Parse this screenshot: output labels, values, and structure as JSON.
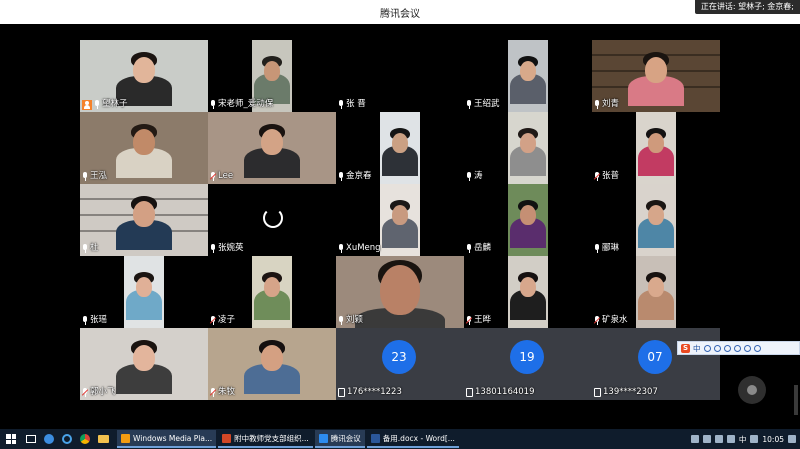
{
  "window": {
    "title": "腾讯会议"
  },
  "speaking": {
    "text": "正在讲话: 望林子; 金京春;"
  },
  "tiles": [
    {
      "name": "望林子",
      "host": true,
      "mic": "on",
      "col": 0,
      "row": 0,
      "active": true,
      "wall": "#c9ccc8",
      "skin": "#e1b59a",
      "shirt": "#2a2a2a",
      "hair": "#1b1411",
      "vl": 0,
      "vw": 128
    },
    {
      "name": "宋老师_爱动保",
      "mic": "on",
      "col": 1,
      "row": 0,
      "wall": "#c7c6bd",
      "skin": "#c79677",
      "shirt": "#6b7b6a",
      "hair": "#22201c",
      "vl": 44,
      "vw": 40
    },
    {
      "name": "张 晋",
      "mic": "on",
      "col": 2,
      "row": 0,
      "blank": true
    },
    {
      "name": "王绍武",
      "mic": "on",
      "col": 3,
      "row": 0,
      "wall": "#bfc3c6",
      "skin": "#d8a98a",
      "shirt": "#5a5f6a",
      "hair": "#111",
      "vl": 44,
      "vw": 40
    },
    {
      "name": "刘青",
      "mic": "on",
      "col": 4,
      "row": 0,
      "wall": "#5a4634",
      "skin": "#d7a384",
      "shirt": "#d97a86",
      "hair": "#1a1410",
      "vl": 0,
      "vw": 128,
      "shelves": true
    },
    {
      "name": "王泓",
      "mic": "on",
      "col": 0,
      "row": 1,
      "wall": "#8c7b6a",
      "skin": "#c18a68",
      "shirt": "#d9d2c4",
      "hair": "#231a14",
      "vl": 0,
      "vw": 128
    },
    {
      "name": "Lee",
      "mic": "off",
      "col": 1,
      "row": 1,
      "wall": "#a89586",
      "skin": "#d3a386",
      "shirt": "#2c2c2e",
      "hair": "#1a1310",
      "vl": 0,
      "vw": 128
    },
    {
      "name": "金京春",
      "mic": "on",
      "col": 2,
      "row": 1,
      "wall": "#dfe3e6",
      "skin": "#caa083",
      "shirt": "#2d3137",
      "hair": "#151515",
      "vl": 44,
      "vw": 40
    },
    {
      "name": "涛",
      "mic": "on",
      "col": 3,
      "row": 1,
      "wall": "#d7d6ce",
      "skin": "#d2a187",
      "shirt": "#8e8e8e",
      "hair": "#1f1916",
      "vl": 44,
      "vw": 40
    },
    {
      "name": "张普",
      "mic": "off",
      "col": 4,
      "row": 1,
      "wall": "#d9d4cc",
      "skin": "#cf9a7c",
      "shirt": "#c23b62",
      "hair": "#141212",
      "vl": 44,
      "vw": 40
    },
    {
      "name": "杜",
      "mic": "on",
      "col": 0,
      "row": 2,
      "wall": "#cfcac4",
      "skin": "#d3a084",
      "shirt": "#233a55",
      "hair": "#161211",
      "vl": 0,
      "vw": 128,
      "shelves": true
    },
    {
      "name": "张婉英",
      "mic": "on",
      "col": 1,
      "row": 2,
      "loading": true
    },
    {
      "name": "XuMeng",
      "mic": "on",
      "col": 2,
      "row": 2,
      "wall": "#e7e2dd",
      "skin": "#c89a80",
      "shirt": "#5f646f",
      "hair": "#1a1717",
      "vl": 44,
      "vw": 40
    },
    {
      "name": "岳麟",
      "mic": "on",
      "col": 3,
      "row": 2,
      "wall": "#6e8b5a",
      "skin": "#c58f74",
      "shirt": "#5a2d6d",
      "hair": "#111",
      "vl": 44,
      "vw": 40
    },
    {
      "name": "郦琳",
      "mic": "on",
      "col": 4,
      "row": 2,
      "wall": "#d9d3cc",
      "skin": "#d6a68a",
      "shirt": "#4e86a6",
      "hair": "#1b1613",
      "vl": 44,
      "vw": 40
    },
    {
      "name": "张瑶",
      "mic": "on",
      "col": 0,
      "row": 3,
      "wall": "#e0e3e4",
      "skin": "#e0b097",
      "shirt": "#6fa9c8",
      "hair": "#1b1512",
      "vl": 44,
      "vw": 40
    },
    {
      "name": "凌子",
      "mic": "off",
      "col": 1,
      "row": 3,
      "wall": "#d8d4c2",
      "skin": "#d6a489",
      "shirt": "#6f8d5a",
      "hair": "#1c1412",
      "vl": 44,
      "vw": 40
    },
    {
      "name": "刘颖",
      "mic": "on",
      "col": 2,
      "row": 3,
      "wall": "#9c8a7c",
      "skin": "#b98166",
      "shirt": "#3a3a3a",
      "hair": "#1a1410",
      "vl": 0,
      "vw": 128,
      "closeup": true
    },
    {
      "name": "王晔",
      "mic": "off",
      "col": 3,
      "row": 3,
      "wall": "#d2cec6",
      "skin": "#d7a78c",
      "shirt": "#1e1e1e",
      "hair": "#151010",
      "vl": 44,
      "vw": 40
    },
    {
      "name": "矿泉水",
      "mic": "off",
      "col": 4,
      "row": 3,
      "wall": "#c8bfb7",
      "skin": "#d9a98d",
      "shirt": "#b98a6e",
      "hair": "#17110f",
      "vl": 44,
      "vw": 40
    },
    {
      "name": "郭小飞",
      "mic": "off",
      "col": 0,
      "row": 4,
      "wall": "#d4d0cb",
      "skin": "#e3b59c",
      "shirt": "#3d3d3d",
      "hair": "#1a1310",
      "vl": 0,
      "vw": 128
    },
    {
      "name": "朱牧",
      "mic": "off",
      "col": 1,
      "row": 4,
      "wall": "#b7a58e",
      "skin": "#d4a082",
      "shirt": "#4d6d95",
      "hair": "#151010",
      "vl": 0,
      "vw": 128
    },
    {
      "name": "176****1223",
      "phone": true,
      "badge": "23",
      "col": 2,
      "row": 4
    },
    {
      "name": "13801164019",
      "phone": true,
      "badge": "19",
      "col": 3,
      "row": 4
    },
    {
      "name": "139****2307",
      "phone": true,
      "badge": "07",
      "col": 4,
      "row": 4
    }
  ],
  "ime": {
    "label": "中"
  },
  "taskbar": {
    "tasks": [
      {
        "label": "Windows Media Pla...",
        "color": "#f39c12",
        "active": true
      },
      {
        "label": "附中教师党支部组织...",
        "color": "#d24726",
        "active": false
      },
      {
        "label": "腾讯会议",
        "color": "#2d8cf0",
        "active": true
      },
      {
        "label": "备用.docx - Word[...",
        "color": "#2b579a",
        "active": false
      }
    ],
    "ime": "中",
    "time": "10:05"
  }
}
